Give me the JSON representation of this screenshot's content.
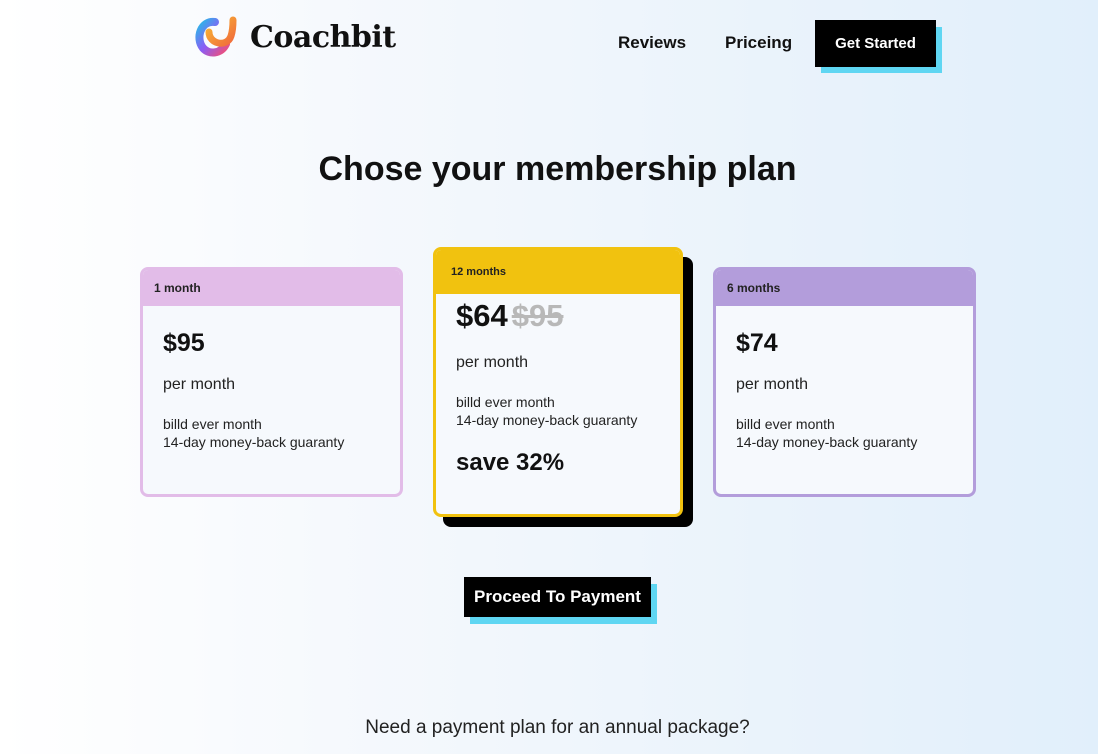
{
  "header": {
    "brand": "Coachbit",
    "nav": [
      {
        "label": "Reviews"
      },
      {
        "label": "Priceing"
      }
    ],
    "cta_label": "Get Started"
  },
  "main": {
    "title": "Chose your membership plan",
    "plans": [
      {
        "duration": "1 month",
        "price": "$95",
        "per": "per month",
        "billing": "billd ever month",
        "guarantee": "14-day money-back guaranty",
        "accent": "#e2bce8"
      },
      {
        "duration": "12 months",
        "price": "$64",
        "old_price": "$95",
        "per": "per month",
        "billing": "billd ever month",
        "guarantee": "14-day money-back guaranty",
        "savings": "save 32%",
        "accent": "#f1c20f",
        "featured": true
      },
      {
        "duration": "6 months",
        "price": "$74",
        "per": "per month",
        "billing": "billd ever month",
        "guarantee": "14-day money-back guaranty",
        "accent": "#b39ddb"
      }
    ],
    "proceed_label": "Proceed To Payment",
    "annual_text": "Need a payment plan for an annual package?"
  },
  "colors": {
    "button_bg": "#000000",
    "button_shadow": "#5fd6f2"
  }
}
